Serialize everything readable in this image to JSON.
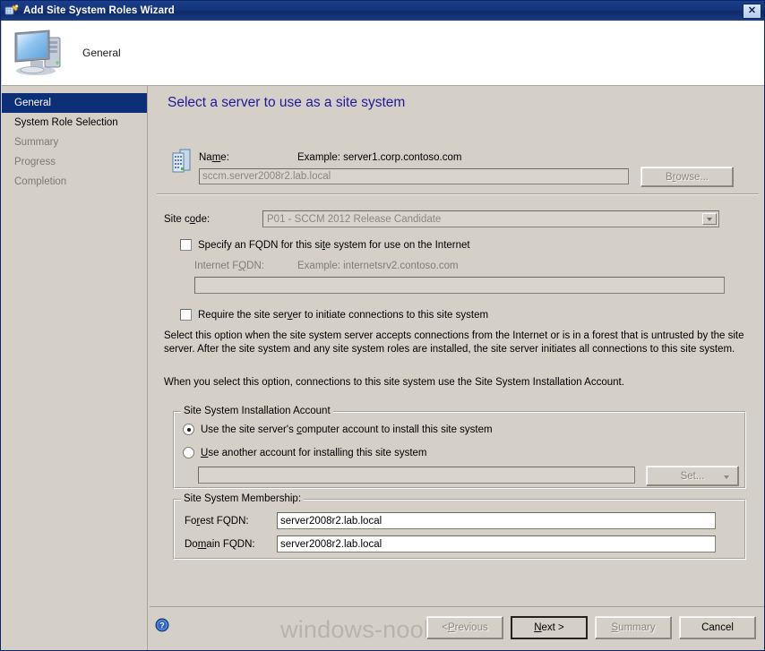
{
  "window": {
    "title": "Add Site System Roles Wizard",
    "icon": "wizard-icon",
    "close_label": "✕"
  },
  "header": {
    "icon": "computer-icon",
    "label": "General"
  },
  "sidebar": {
    "items": [
      {
        "label": "General",
        "state": "active"
      },
      {
        "label": "System Role Selection",
        "state": "enabled"
      },
      {
        "label": "Summary",
        "state": "disabled"
      },
      {
        "label": "Progress",
        "state": "disabled"
      },
      {
        "label": "Completion",
        "state": "disabled"
      }
    ]
  },
  "main": {
    "page_title": "Select a server to use as a site system",
    "server_icon": "server-icon",
    "name": {
      "label": "Na<u>m</u>e:",
      "example": "Example: server1.corp.contoso.com",
      "value": "sccm.server2008r2.lab.local",
      "browse_label": "B<u>r</u>owse..."
    },
    "site_code": {
      "label": "Site c<u>o</u>de:",
      "value": "P01 - SCCM 2012 Release Candidate"
    },
    "fqdn_checkbox": {
      "label": "Specify an FQDN for this si<u>t</u>e system for use on the Internet",
      "checked": false
    },
    "internet_fqdn": {
      "label": "Internet F<u>Q</u>DN:",
      "example": "Example: internetsrv2.contoso.com",
      "value": ""
    },
    "require_checkbox": {
      "label": "Require the site ser<u>v</u>er to initiate connections to this site system",
      "checked": false
    },
    "description_1": "Select this option when the site system server accepts connections from the Internet or is in a forest that is untrusted by the site server. After the site system and any site system roles are installed, the site server initiates all connections to this site system.",
    "description_2": "When you select this option, connections to this site system use the Site System Installation Account.",
    "install_account": {
      "group_title": "Site System Installation Account",
      "option_computer": "Use the site server's <u>c</u>omputer account to install this site system",
      "option_another": "<u>U</u>se another account for installing this site system",
      "selected": "computer",
      "account_value": "",
      "set_label": "Set..."
    },
    "membership": {
      "group_title": "Site System Membership:",
      "forest_label": "Fo<u>r</u>est FQDN:",
      "forest_value": "server2008r2.lab.local",
      "domain_label": "Do<u>m</u>ain FQDN:",
      "domain_value": "server2008r2.lab.local"
    }
  },
  "footer": {
    "help_icon": "help-icon",
    "watermark": "windows-noob.com",
    "buttons": [
      {
        "label": "< <u>P</u>revious",
        "state": "disabled"
      },
      {
        "label": "<u>N</u>ext >",
        "state": "default"
      },
      {
        "label": "<u>S</u>ummary",
        "state": "disabled"
      },
      {
        "label": "Cancel",
        "state": "enabled"
      }
    ]
  },
  "colors": {
    "titlebar": "#15357a",
    "accent_heading": "#21199c",
    "nav_active_bg": "#0c2f78",
    "window_bg": "#d4d0c8"
  }
}
